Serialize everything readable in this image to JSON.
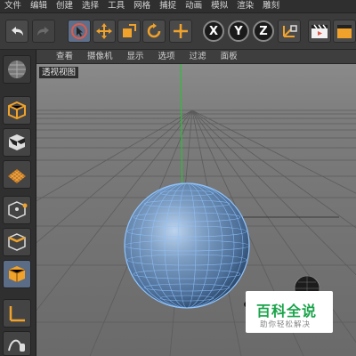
{
  "menu": {
    "items": [
      "文件",
      "编辑",
      "创建",
      "选择",
      "工具",
      "网格",
      "捕捉",
      "动画",
      "模拟",
      "渲染",
      "雕刻"
    ]
  },
  "toolbar": {
    "undo_icon": "undo-icon",
    "redo_icon": "redo-icon",
    "axis_x": "X",
    "axis_y": "Y",
    "axis_z": "Z"
  },
  "viewport_menu": {
    "items": [
      "查看",
      "摄像机",
      "显示",
      "选项",
      "过滤",
      "面板"
    ]
  },
  "viewport": {
    "label": "透视视图"
  },
  "watermark": {
    "title": "百科全说",
    "subtitle": "助你轻松解决"
  },
  "colors": {
    "sphere": "#5f86b5",
    "wireframe": "#8fc4ff",
    "y_axis": "#2fbd3a",
    "grid_bg": "#7a7a7a",
    "accent_orange": "#f0a22a"
  }
}
